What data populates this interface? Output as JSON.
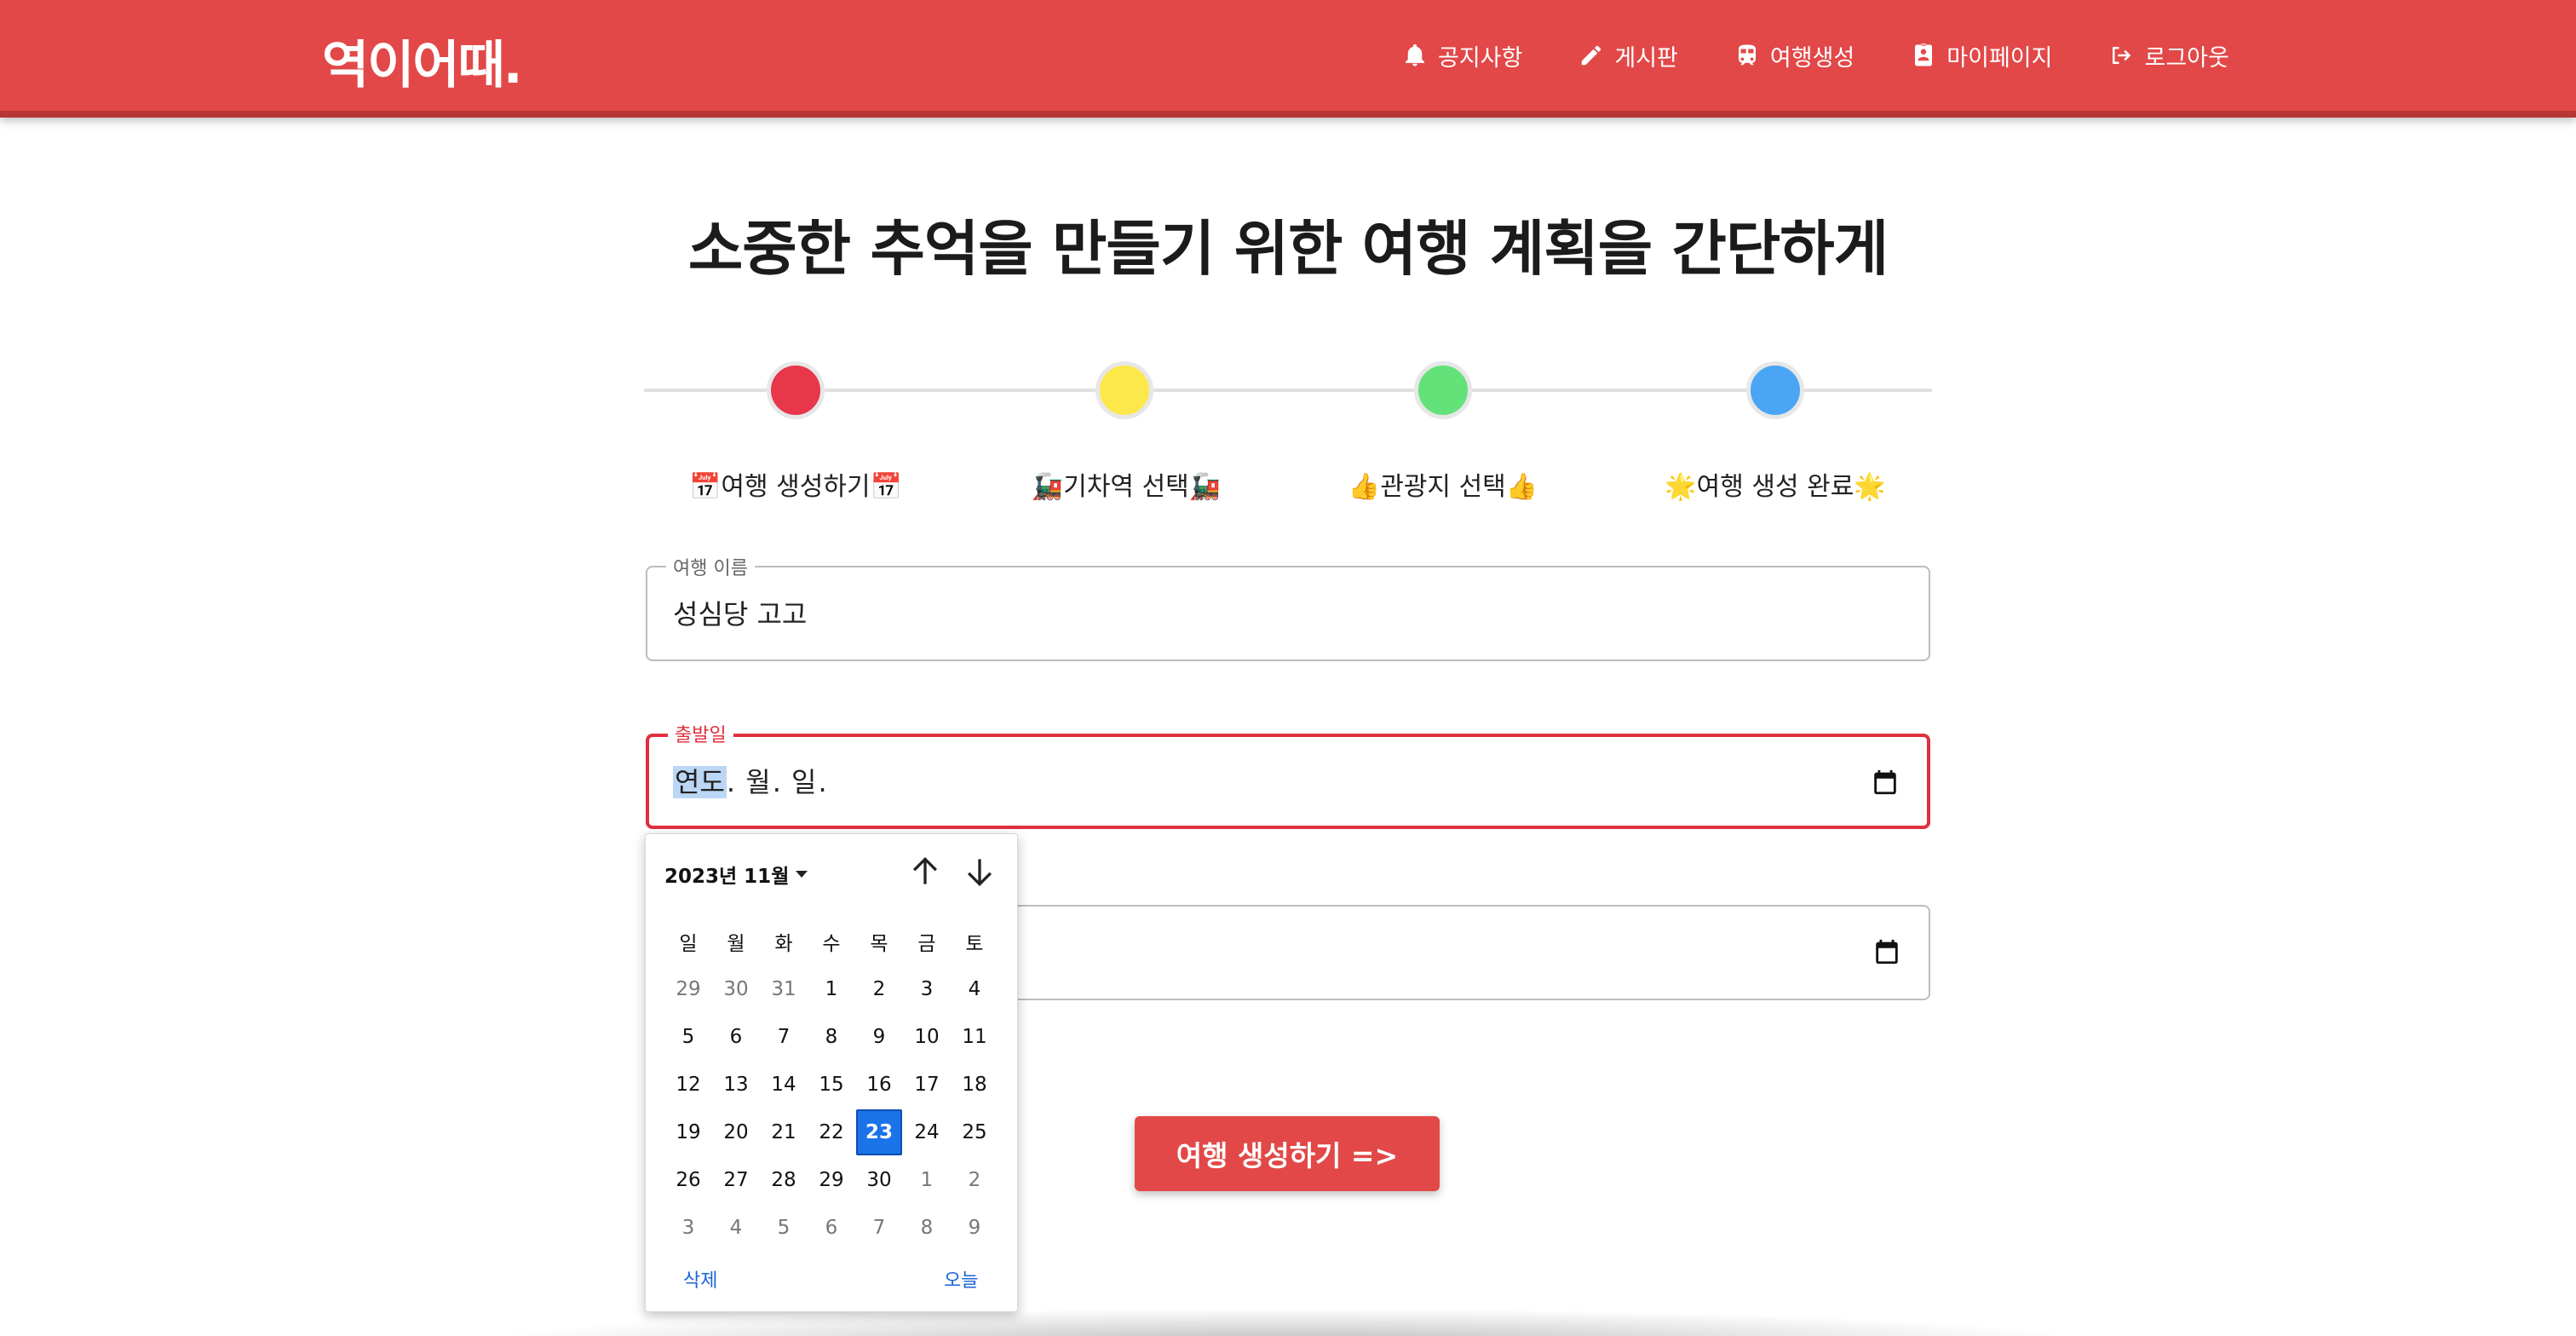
{
  "header": {
    "logo": "역이어때.",
    "nav": [
      {
        "label": "공지사항",
        "icon": "bell-icon"
      },
      {
        "label": "게시판",
        "icon": "pencil-icon"
      },
      {
        "label": "여행생성",
        "icon": "train-icon"
      },
      {
        "label": "마이페이지",
        "icon": "profile-icon"
      },
      {
        "label": "로그아웃",
        "icon": "logout-icon"
      }
    ]
  },
  "headline": "소중한 추억을 만들기 위한 여행 계획을 간단하게",
  "stepper": {
    "steps": [
      {
        "label": "📅여행 생성하기📅",
        "color": "#e8364a"
      },
      {
        "label": "🚂기차역 선택🚂",
        "color": "#fce84a"
      },
      {
        "label": "👍관광지 선택👍",
        "color": "#63e27a"
      },
      {
        "label": "🌟여행 생성 완료🌟",
        "color": "#4aa6f5"
      }
    ]
  },
  "form": {
    "trip_name": {
      "label": "여행 이름",
      "value": "성심당 고고"
    },
    "departure": {
      "label": "출발일",
      "segments": {
        "year": "연도",
        "month": "월",
        "day": "일"
      }
    },
    "arrival": {
      "label": "",
      "value": ""
    },
    "submit_label": "여행 생성하기 =>"
  },
  "calendar": {
    "month_label": "2023년 11월",
    "weekdays": [
      "일",
      "월",
      "화",
      "수",
      "목",
      "금",
      "토"
    ],
    "weeks": [
      [
        "29",
        "30",
        "31",
        "1",
        "2",
        "3",
        "4"
      ],
      [
        "5",
        "6",
        "7",
        "8",
        "9",
        "10",
        "11"
      ],
      [
        "12",
        "13",
        "14",
        "15",
        "16",
        "17",
        "18"
      ],
      [
        "19",
        "20",
        "21",
        "22",
        "23",
        "24",
        "25"
      ],
      [
        "26",
        "27",
        "28",
        "29",
        "30",
        "1",
        "2"
      ],
      [
        "3",
        "4",
        "5",
        "6",
        "7",
        "8",
        "9"
      ]
    ],
    "today": "23",
    "clear_label": "삭제",
    "today_label": "오늘"
  },
  "colors": {
    "brand": "#e24848",
    "focus": "#e0303e",
    "calendar_selected": "#1a73e8"
  }
}
